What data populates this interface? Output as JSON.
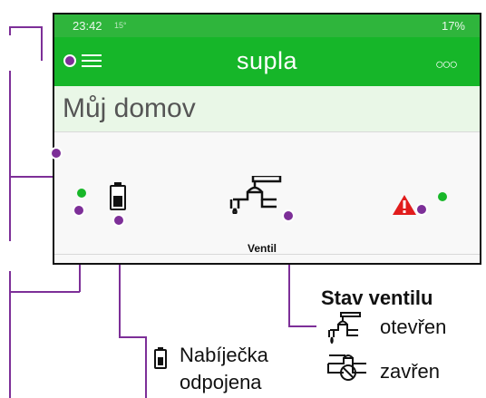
{
  "status_bar": {
    "time": "23:42",
    "small": "15°",
    "right": "17%"
  },
  "app_bar": {
    "title": "supla"
  },
  "room": {
    "title": "Můj domov"
  },
  "device": {
    "label": "Ventil"
  },
  "legend": {
    "title": "Stav ventilu",
    "open": "otevřen",
    "closed": "zavřen"
  },
  "charger": {
    "line1": "Nabíječka",
    "line2": "odpojena"
  },
  "colors": {
    "brand_green": "#16b629",
    "annotation": "#7d2f98",
    "alert": "#e11d1d"
  }
}
